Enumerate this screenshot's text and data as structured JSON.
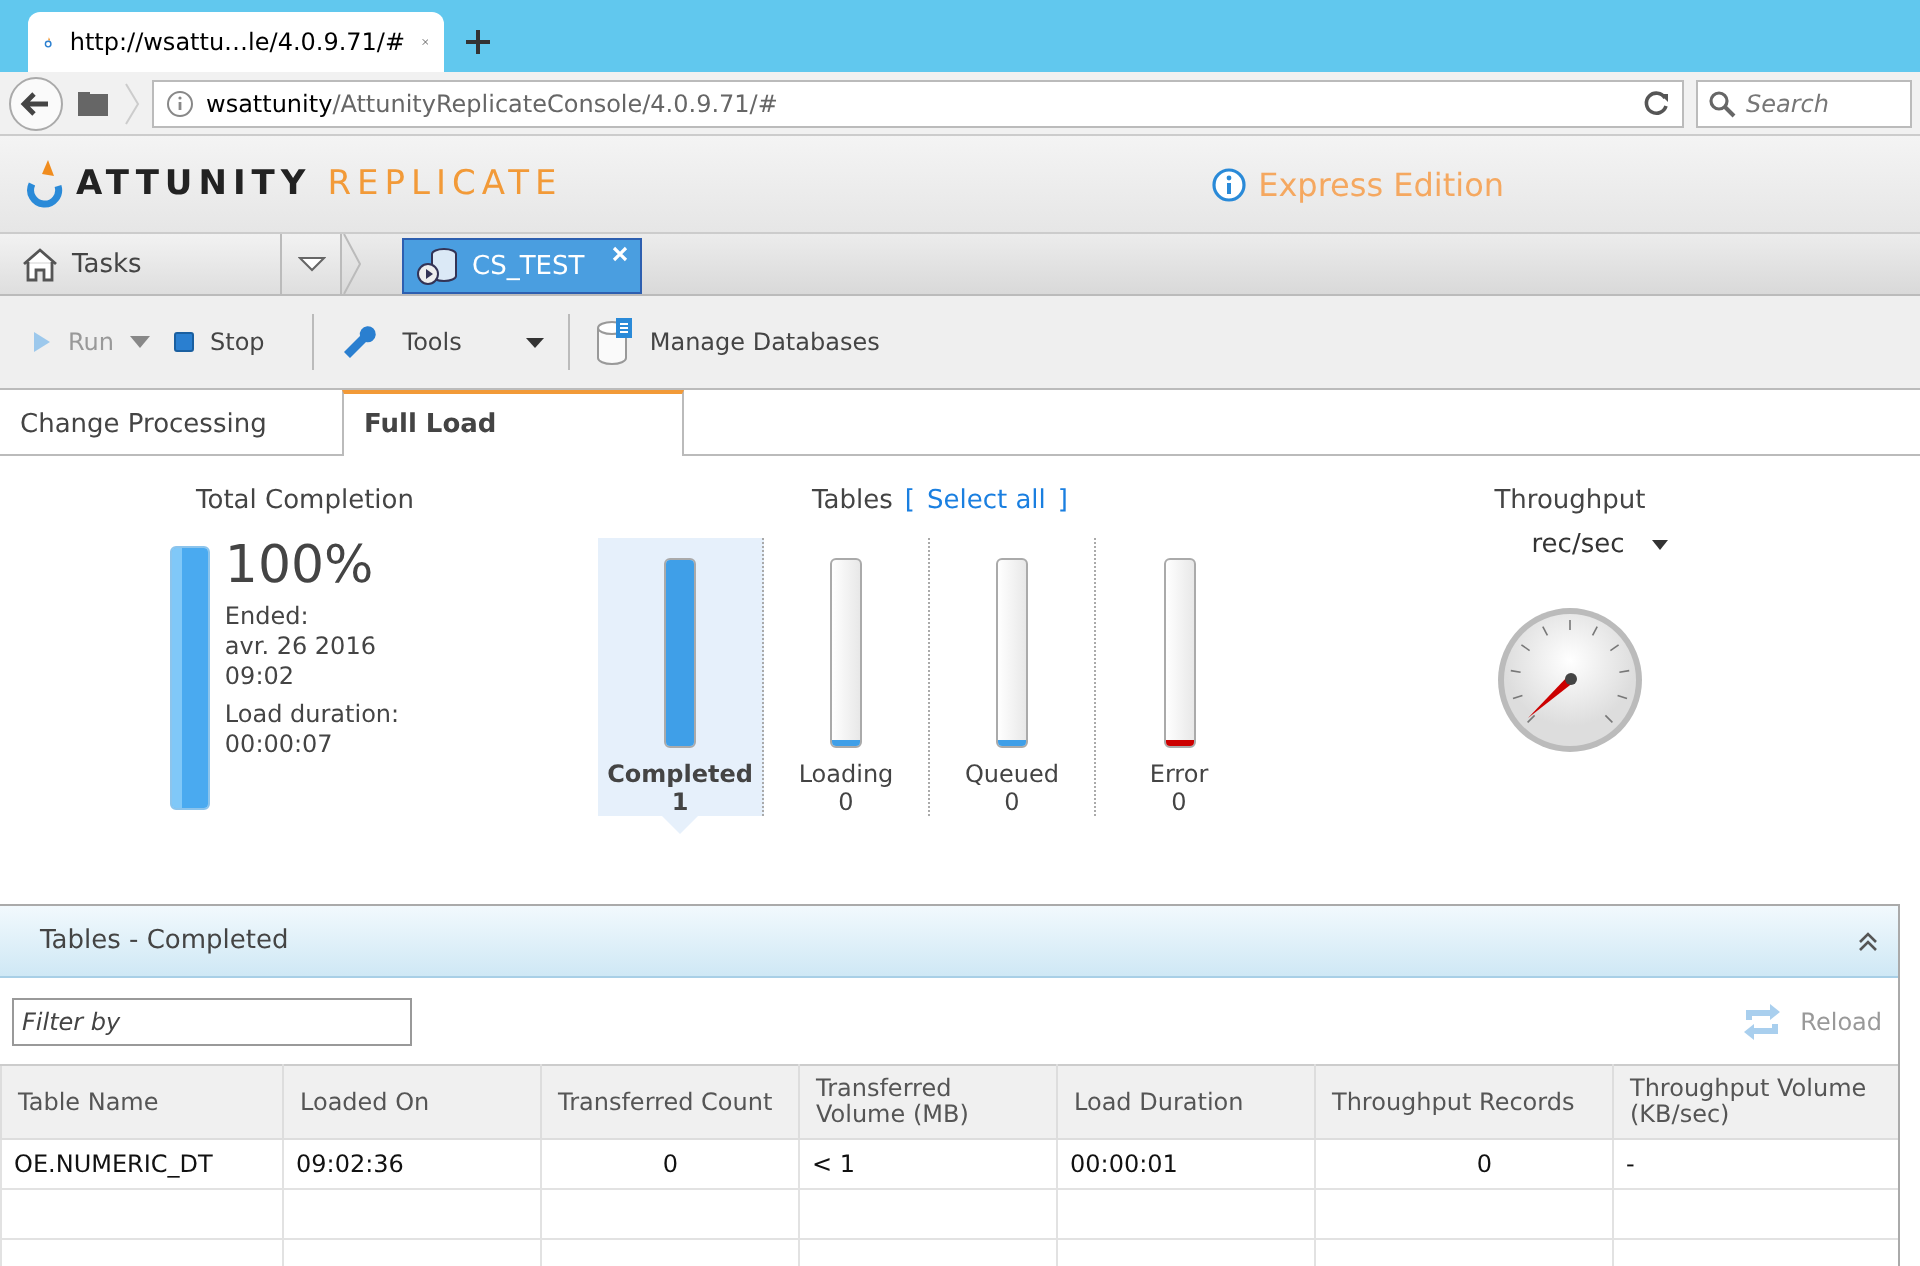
{
  "browser": {
    "tab_title": "http://wsattu…le/4.0.9.71/#",
    "url_host": "wsattunity",
    "url_path": "/AttunityReplicateConsole/4.0.9.71/#",
    "search_placeholder": "Search"
  },
  "header": {
    "logo_primary": "ATTUNITY",
    "logo_secondary": "REPLICATE",
    "edition": "Express Edition"
  },
  "task_tabs": {
    "home": "Tasks",
    "tabs": [
      {
        "label": "CS_TEST",
        "selected": true
      }
    ]
  },
  "toolbar": [
    {
      "kind": "run",
      "label": "Run",
      "disabled": true
    },
    {
      "kind": "stop",
      "label": "Stop",
      "disabled": false
    },
    {
      "kind": "tools",
      "label": "Tools",
      "disabled": false
    },
    {
      "kind": "manage",
      "label": "Manage Databases",
      "disabled": false
    }
  ],
  "view_tabs": [
    {
      "label": "Change Processing",
      "selected": false
    },
    {
      "label": "Full Load",
      "selected": true
    }
  ],
  "total_completion": {
    "title": "Total Completion",
    "percent": "100%",
    "level": 1,
    "ended_label": "Ended:",
    "ended_date": "avr. 26 2016",
    "ended_time": "09:02",
    "duration_label": "Load duration:",
    "duration": "00:00:07"
  },
  "tables": {
    "title": "Tables",
    "open_bracket": "[",
    "select_all": "Select all",
    "close_bracket": "]",
    "bars": [
      {
        "label": "Completed",
        "count": "1",
        "level": 1,
        "selected": true,
        "color": "#3f9fe8"
      },
      {
        "label": "Loading",
        "count": "0",
        "level": 0,
        "selected": false,
        "color": "#3f9fe8"
      },
      {
        "label": "Queued",
        "count": "0",
        "level": 0,
        "selected": false,
        "color": "#3f9fe8"
      },
      {
        "label": "Error",
        "count": "0",
        "level": 0,
        "selected": false,
        "color": "#cc0000"
      }
    ]
  },
  "throughput": {
    "title": "Throughput",
    "unit": "rec/sec"
  },
  "panel": {
    "title": "Tables - Completed",
    "filter_placeholder": "Filter by",
    "reload": "Reload",
    "reload_disabled": true,
    "columns": [
      {
        "label": "Table Name",
        "kind": "text"
      },
      {
        "label": "Loaded On",
        "kind": "text"
      },
      {
        "label": "Transferred Count",
        "kind": "number"
      },
      {
        "label": "Transferred Volume (MB)",
        "kind": "text"
      },
      {
        "label": "Load Duration",
        "kind": "text"
      },
      {
        "label": "Throughput Records",
        "kind": "number"
      },
      {
        "label": "Throughput Volume (KB/sec)",
        "kind": "text"
      }
    ],
    "rows": [
      [
        "OE.NUMERIC_DT",
        "09:02:36",
        "0",
        "< 1",
        "00:00:01",
        "0",
        "-"
      ]
    ]
  }
}
